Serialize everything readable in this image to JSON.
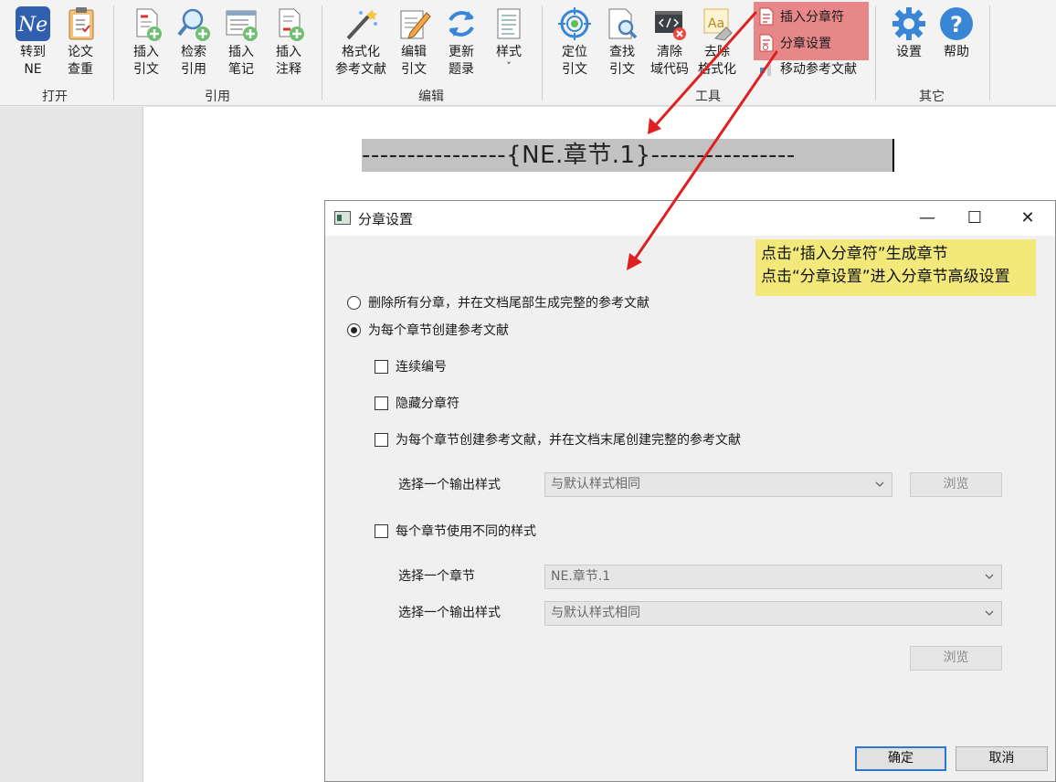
{
  "ribbon": {
    "groups": {
      "open": "打开",
      "cite": "引用",
      "edit": "编辑",
      "tools": "工具",
      "other": "其它"
    },
    "buttons": {
      "goto_ne": [
        "转到",
        "NE"
      ],
      "paper_check": [
        "论文",
        "查重"
      ],
      "insert_cite": [
        "插入",
        "引文"
      ],
      "search_cite": [
        "检索",
        "引用"
      ],
      "insert_note": [
        "插入",
        "笔记"
      ],
      "insert_annot": [
        "插入",
        "注释"
      ],
      "format_refs": [
        "格式化",
        "参考文献"
      ],
      "edit_cite": [
        "编辑",
        "引文"
      ],
      "update_list": [
        "更新",
        "题录"
      ],
      "style": [
        "样式",
        "˅"
      ],
      "locate_cite": [
        "定位",
        "引文"
      ],
      "find_cite": [
        "查找",
        "引文"
      ],
      "clear_code": [
        "清除",
        "域代码"
      ],
      "remove_format": [
        "去除",
        "格式化"
      ],
      "settings": [
        "设置"
      ],
      "help": [
        "帮助"
      ]
    },
    "small_buttons": {
      "insert_chapter": "插入分章符",
      "chapter_settings": "分章设置",
      "move_refs": "移动参考文献"
    },
    "icon_text": {
      "ne_logo": "Ne",
      "aa": "Aa",
      "help_q": "?"
    }
  },
  "document": {
    "field_code": "----------------{NE.章节.1}----------------"
  },
  "dialog": {
    "title": "分章设置",
    "controls": {
      "minimize": "—",
      "maximize": "☐",
      "close": "✕"
    },
    "radio_delete_all": "删除所有分章，并在文档尾部生成完整的参考文献",
    "radio_per_chapter": "为每个章节创建参考文献",
    "check_continuous": "连续编号",
    "check_hide": "隐藏分章符",
    "check_per_chapter_full": "为每个章节创建参考文献，并在文档末尾创建完整的参考文献",
    "select_output_style_1": "选择一个输出样式",
    "output_style_value_1": "与默认样式相同",
    "browse_1": "浏览",
    "check_different_styles": "每个章节使用不同的样式",
    "select_chapter": "选择一个章节",
    "chapter_value": "NE.章节.1",
    "select_output_style_2": "选择一个输出样式",
    "output_style_value_2": "与默认样式相同",
    "browse_2": "浏览",
    "ok": "确定",
    "cancel": "取消"
  },
  "annotation": {
    "line1": "点击“插入分章符”生成章节",
    "line2": "点击“分章设置”进入分章节高级设置"
  },
  "colors": {
    "highlight": "#e8878a",
    "note_bg": "#f2e97a",
    "arrow": "#e02020",
    "accent_blue": "#2a78d4"
  }
}
